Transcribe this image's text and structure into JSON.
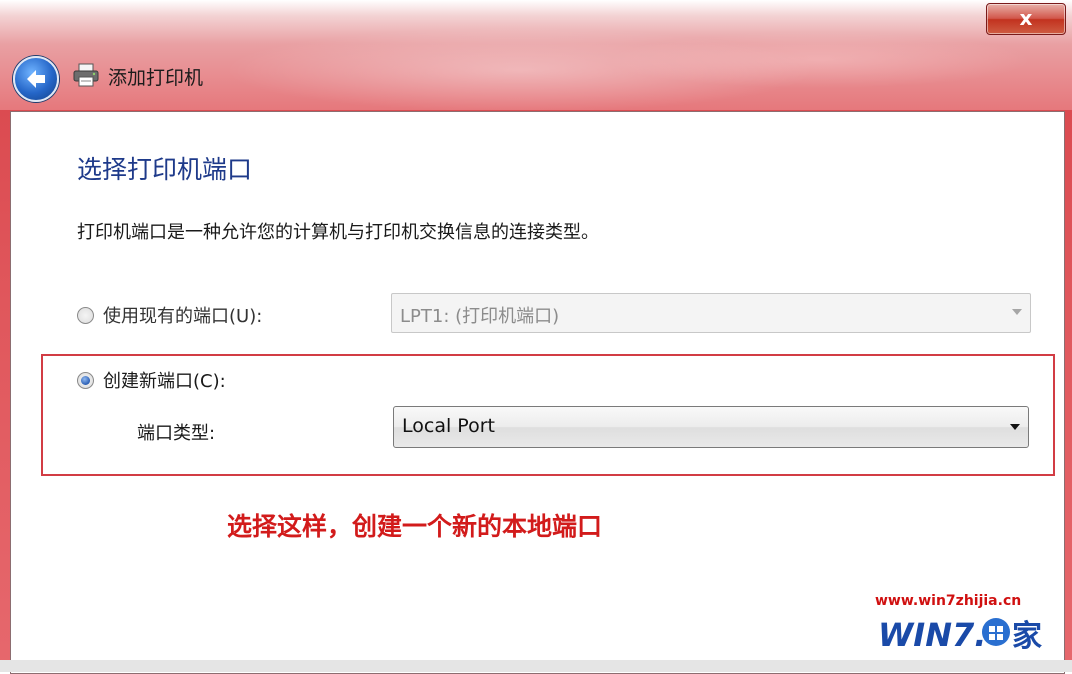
{
  "window": {
    "title": "添加打印机",
    "close_label": "x"
  },
  "page": {
    "title": "选择打印机端口",
    "description": "打印机端口是一种允许您的计算机与打印机交换信息的连接类型。"
  },
  "existing_port": {
    "label": "使用现有的端口(U):",
    "selected": false,
    "select_value": "LPT1: (打印机端口)",
    "enabled": false
  },
  "new_port": {
    "label": "创建新端口(C):",
    "selected": true,
    "type_label": "端口类型:",
    "type_value": "Local Port"
  },
  "annotation": {
    "text": "选择这样，创建一个新的本地端口",
    "color": "#d21b1b"
  },
  "watermark": {
    "url": "www.win7zhijia.cn",
    "logo_text": "WIN7.之家"
  },
  "colors": {
    "title_blue": "#1e3a8a",
    "highlight_red": "#d23c44",
    "frame_red": "#d8444a"
  }
}
